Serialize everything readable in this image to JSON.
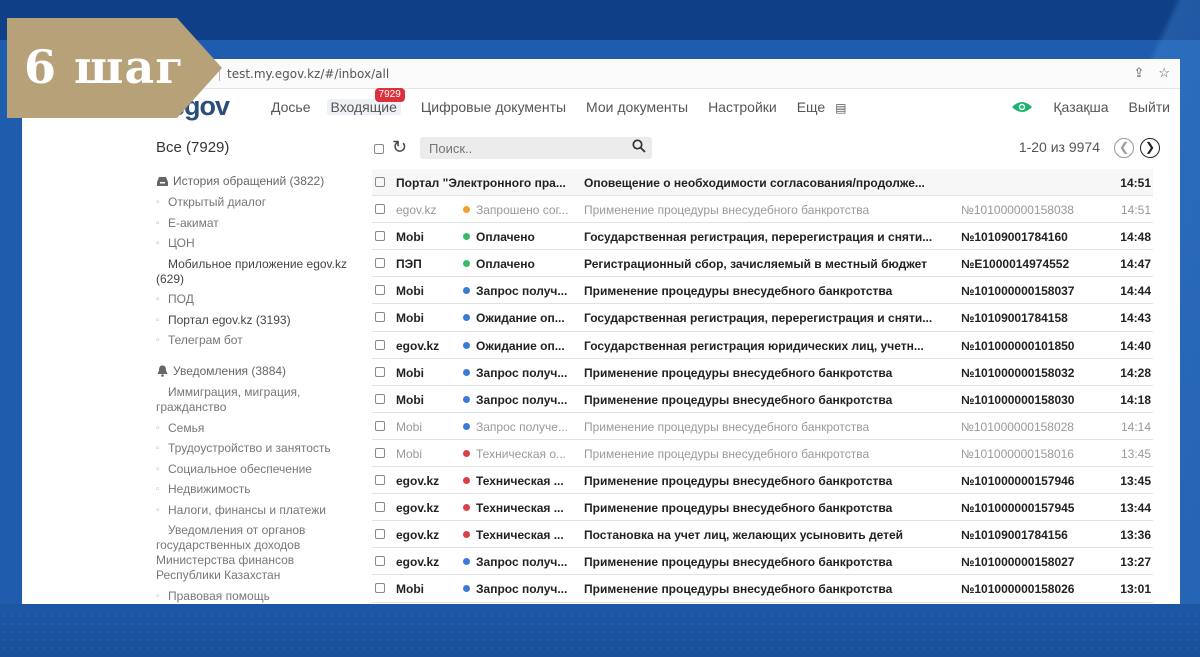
{
  "step_label": "6 шаг",
  "browser": {
    "url": "test.my.egov.kz/#/inbox/all"
  },
  "nav": {
    "logo": "egov",
    "items": [
      "Досье",
      "Входящие",
      "Цифровые документы",
      "Мои документы",
      "Настройки",
      "Еще"
    ],
    "inbox_badge": "7929",
    "lang": "Қазақша",
    "logout": "Выйти"
  },
  "sidebar": {
    "all": "Все (7929)",
    "groups": [
      {
        "title": "История обращений (3822)",
        "icon": "inbox-icon",
        "items": [
          {
            "label": "Открытый диалог",
            "strong": false
          },
          {
            "label": "Е-акимат",
            "strong": false
          },
          {
            "label": "ЦОН",
            "strong": false
          },
          {
            "label": "Мобильное приложение egov.kz (629)",
            "strong": true
          },
          {
            "label": "ПОД",
            "strong": false
          },
          {
            "label": "Портал egov.kz (3193)",
            "strong": true
          },
          {
            "label": "Телеграм бот",
            "strong": false
          }
        ]
      },
      {
        "title": "Уведомления (3884)",
        "icon": "bell-icon",
        "items": [
          {
            "label": "Иммиграция, миграция, гражданство",
            "strong": false
          },
          {
            "label": "Семья",
            "strong": false
          },
          {
            "label": "Трудоустройство и занятость",
            "strong": false
          },
          {
            "label": "Социальное обеспечение",
            "strong": false
          },
          {
            "label": "Недвижимость",
            "strong": false
          },
          {
            "label": "Налоги, финансы и платежи",
            "strong": false
          },
          {
            "label": "Уведомления от органов государственных доходов Министерства финансов Республики Казахстан",
            "strong": false
          },
          {
            "label": "Правовая помощь",
            "strong": false
          }
        ]
      }
    ]
  },
  "toolbar": {
    "search_placeholder": "Поиск..",
    "pager": "1-20 из 9974"
  },
  "colors": {
    "green": "#3cb86a",
    "orange": "#f0a030",
    "blue": "#3a7bd5",
    "red": "#d9404a"
  },
  "messages": [
    {
      "source": "Портал \"Электронного пра...",
      "status": "",
      "status_color": "",
      "subject": "Оповещение о необходимости согласования/продолже...",
      "number": "",
      "time": "14:51",
      "read": false,
      "first": true
    },
    {
      "source": "egov.kz",
      "status": "Запрошено сог...",
      "status_color": "orange",
      "subject": "Применение процедуры внесудебного банкротства",
      "number": "№101000000158038",
      "time": "14:51",
      "read": true
    },
    {
      "source": "Mobi",
      "status": "Оплачено",
      "status_color": "green",
      "subject": "Государственная регистрация, перерегистрация и сняти...",
      "number": "№10109001784160",
      "time": "14:48",
      "read": false
    },
    {
      "source": "ПЭП",
      "status": "Оплачено",
      "status_color": "green",
      "subject": "Регистрационный сбор, зачисляемый в местный бюджет",
      "number": "№E1000014974552",
      "time": "14:47",
      "read": false
    },
    {
      "source": "Mobi",
      "status": "Запрос получ...",
      "status_color": "blue",
      "subject": "Применение процедуры внесудебного банкротства",
      "number": "№101000000158037",
      "time": "14:44",
      "read": false
    },
    {
      "source": "Mobi",
      "status": "Ожидание оп...",
      "status_color": "blue",
      "subject": "Государственная регистрация, перерегистрация и сняти...",
      "number": "№10109001784158",
      "time": "14:43",
      "read": false
    },
    {
      "source": "egov.kz",
      "status": "Ожидание оп...",
      "status_color": "blue",
      "subject": "Государственная регистрация юридических лиц, учетн...",
      "number": "№101000000101850",
      "time": "14:40",
      "read": false
    },
    {
      "source": "Mobi",
      "status": "Запрос получ...",
      "status_color": "blue",
      "subject": "Применение процедуры внесудебного банкротства",
      "number": "№101000000158032",
      "time": "14:28",
      "read": false
    },
    {
      "source": "Mobi",
      "status": "Запрос получ...",
      "status_color": "blue",
      "subject": "Применение процедуры внесудебного банкротства",
      "number": "№101000000158030",
      "time": "14:18",
      "read": false
    },
    {
      "source": "Mobi",
      "status": "Запрос получе...",
      "status_color": "blue",
      "subject": "Применение процедуры внесудебного банкротства",
      "number": "№101000000158028",
      "time": "14:14",
      "read": true
    },
    {
      "source": "Mobi",
      "status": "Техническая о...",
      "status_color": "red",
      "subject": "Применение процедуры внесудебного банкротства",
      "number": "№101000000158016",
      "time": "13:45",
      "read": true
    },
    {
      "source": "egov.kz",
      "status": "Техническая ...",
      "status_color": "red",
      "subject": "Применение процедуры внесудебного банкротства",
      "number": "№101000000157946",
      "time": "13:45",
      "read": false
    },
    {
      "source": "egov.kz",
      "status": "Техническая ...",
      "status_color": "red",
      "subject": "Применение процедуры внесудебного банкротства",
      "number": "№101000000157945",
      "time": "13:44",
      "read": false
    },
    {
      "source": "egov.kz",
      "status": "Техническая ...",
      "status_color": "red",
      "subject": "Постановка на учет лиц, желающих усыновить детей",
      "number": "№10109001784156",
      "time": "13:36",
      "read": false
    },
    {
      "source": "egov.kz",
      "status": "Запрос получ...",
      "status_color": "blue",
      "subject": "Применение процедуры внесудебного банкротства",
      "number": "№101000000158027",
      "time": "13:27",
      "read": false
    },
    {
      "source": "Mobi",
      "status": "Запрос получ...",
      "status_color": "blue",
      "subject": "Применение процедуры внесудебного банкротства",
      "number": "№101000000158026",
      "time": "13:01",
      "read": false
    }
  ]
}
